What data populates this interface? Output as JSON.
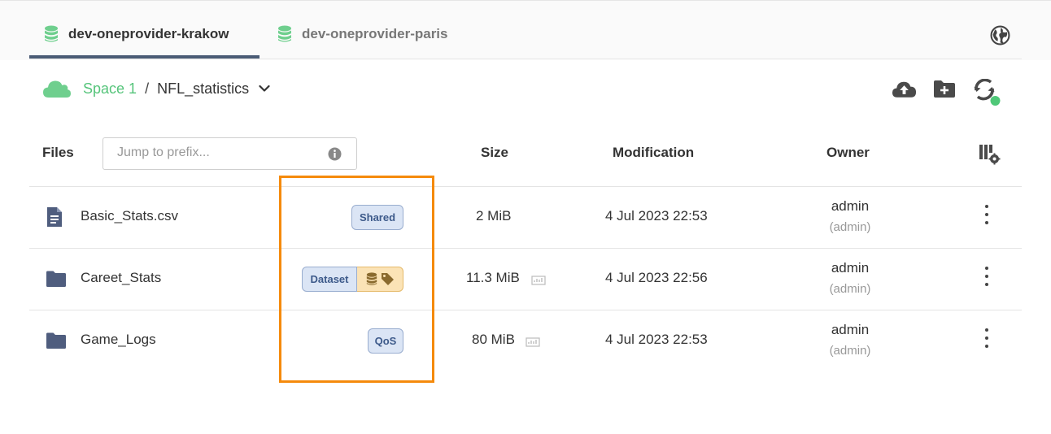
{
  "tabs": [
    {
      "label": "dev-oneprovider-krakow",
      "active": true
    },
    {
      "label": "dev-oneprovider-paris",
      "active": false
    }
  ],
  "breadcrumb": {
    "space": "Space 1",
    "separator": "/",
    "directory": "NFL_statistics"
  },
  "table": {
    "headers": {
      "files": "Files",
      "size": "Size",
      "modification": "Modification",
      "owner": "Owner"
    },
    "prefix_placeholder": "Jump to prefix...",
    "rows": [
      {
        "name": "Basic_Stats.csv",
        "type": "file",
        "badge": "Shared",
        "size": "2 MiB",
        "modified": "4 Jul 2023 22:53",
        "owner": "admin",
        "owner_sub": "(admin)"
      },
      {
        "name": "Careet_Stats",
        "type": "folder",
        "badge": "Dataset",
        "size": "11.3 MiB",
        "modified": "4 Jul 2023 22:56",
        "owner": "admin",
        "owner_sub": "(admin)"
      },
      {
        "name": "Game_Logs",
        "type": "folder",
        "badge": "QoS",
        "size": "80 MiB",
        "modified": "4 Jul 2023 22:53",
        "owner": "admin",
        "owner_sub": "(admin)"
      }
    ]
  },
  "colors": {
    "accent_green": "#55c47a",
    "tab_underline": "#4a5b75",
    "highlight": "#f58a0c",
    "badge_blue": "#dbe5f5",
    "badge_orange": "#fbe3b6"
  },
  "icons": [
    "database-icon",
    "globe-icon",
    "cloud-icon",
    "chevron-down-icon",
    "upload-icon",
    "new-folder-icon",
    "sync-icon",
    "info-icon",
    "columns-settings-icon",
    "file-icon",
    "folder-icon",
    "size-stats-icon",
    "kebab-menu-icon"
  ]
}
